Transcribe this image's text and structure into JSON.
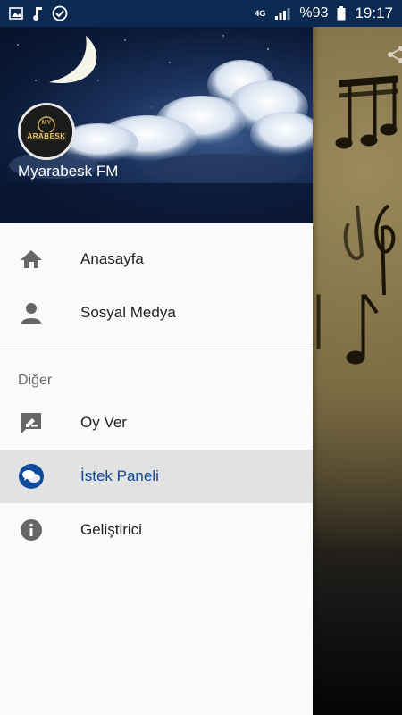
{
  "status_bar": {
    "network": "4G",
    "battery": "%93",
    "time": "19:17",
    "icons": [
      "image-icon",
      "music-note-icon",
      "check-circle-icon",
      "network-4g-icon",
      "signal-icon",
      "battery-icon"
    ]
  },
  "drawer": {
    "header": {
      "station_name": "Myarabesk FM",
      "logo_text": "ARABESK",
      "logo_small": "MY"
    },
    "items": [
      {
        "label": "Anasayfa",
        "icon": "home-icon"
      },
      {
        "label": "Sosyal Medya",
        "icon": "person-icon"
      }
    ],
    "section_title": "Diğer",
    "other_items": [
      {
        "label": "Oy Ver",
        "icon": "rate-review-icon"
      },
      {
        "label": "İstek Paneli",
        "icon": "chat-bubble-icon",
        "active": true
      },
      {
        "label": "Geliştirici",
        "icon": "info-icon"
      }
    ]
  },
  "colors": {
    "status_bar": "#0a2a52",
    "active_text": "#0d4a9a",
    "active_bg": "#e2e2e2",
    "icon_gray": "#666666"
  }
}
